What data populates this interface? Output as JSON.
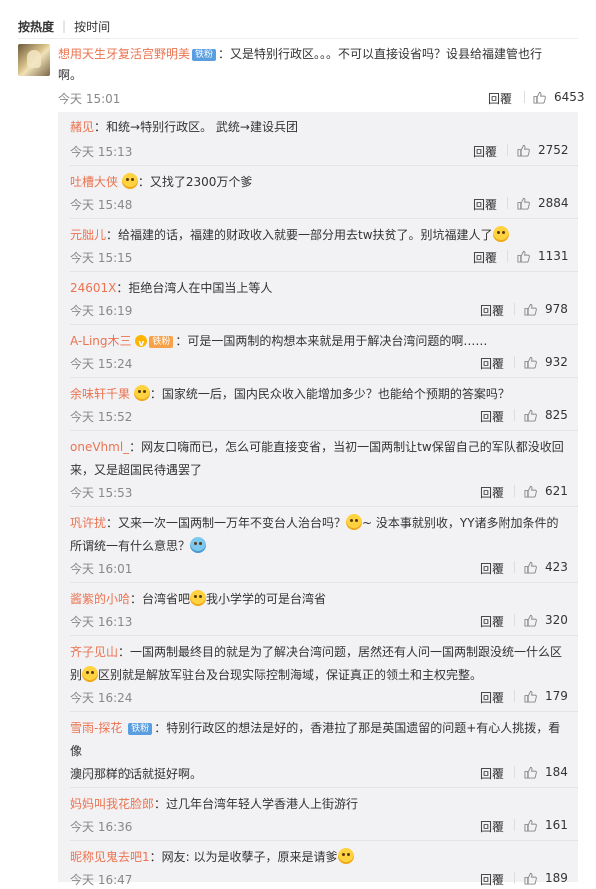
{
  "sort": {
    "hot": "按热度",
    "time": "按时间"
  },
  "main_comment": {
    "user": "想用天生牙复活宫野明美",
    "badge": "铁粉",
    "text_line1": "：又是特别行政区。。。不可以直接设省吗？设县给福建管也行",
    "text_line2": "啊。",
    "time": "今天 15:01",
    "reply_label": "回覆",
    "likes": "6453"
  },
  "reply_label": "回覆",
  "replies": [
    {
      "user": "赭见",
      "line1": "：和统→特别行政区。 武统→建设兵团",
      "line2": "",
      "time": "今天 15:13",
      "likes": "2752"
    },
    {
      "user": "吐槽大侠",
      "line1": "：又找了2300万个爹",
      "line2": "",
      "time": "今天 15:48",
      "likes": "2884"
    },
    {
      "user": "元胐儿",
      "line1": "：给福建的话，福建的财政收入就要一部分用去tw扶贫了。别坑福建人了",
      "line2": "",
      "time": "今天 15:15",
      "likes": "1131"
    },
    {
      "user": "24601X",
      "line1": "：拒绝台湾人在中国当上等人",
      "line2": "",
      "time": "今天 16:19",
      "likes": "978"
    },
    {
      "user": "A-Ling木三",
      "badge": "铁粉",
      "line1": "：可是一国两制的构想本来就是用于解决台湾问题的啊……",
      "line2": "",
      "time": "今天 15:24",
      "likes": "932"
    },
    {
      "user": "余味轩千果",
      "line1": "：国家统一后，国内民众收入能增加多少？也能给个预期的答案吗？",
      "line2": "",
      "time": "今天 15:52",
      "likes": "825"
    },
    {
      "user": "oneVhml_",
      "line1": "：网友口嗨而已，怎么可能直接变省，当初一国两制让tw保留自己的军队都没收回",
      "line2": "来，又是超国民待遇罢了",
      "time": "今天 15:53",
      "likes": "621"
    },
    {
      "user": "巩许扰",
      "line1": "：又来一次一国两制一万年不变台人治台吗？",
      "line1b": "~ 没本事就别收，YY诸多附加条件的",
      "line2": "所谓统一有什么意思？",
      "time": "今天 16:01",
      "likes": "423"
    },
    {
      "user": "酱紫的小哈",
      "line1": "：台湾省吧",
      "line1b": "我小学学的可是台湾省",
      "line2": "",
      "time": "今天 16:13",
      "likes": "320"
    },
    {
      "user": "齐子见山",
      "line1": "：一国两制最终目的就是为了解决台湾问题，居然还有人问一国两制跟没统一什么区",
      "line2a": "别",
      "line2": "区别就是解放军驻台及台现实际控制海域，保证真正的领土和主权完整。",
      "time": "今天 16:24",
      "likes": "179"
    },
    {
      "user": "雪雨-探花",
      "badge": "铁粉",
      "line1": "：特别行政区的想法是好的，香港拉了那是英国遗留的问题+有心人挑拨，看像",
      "line2": "澳门那样的话就挺好啊。",
      "time": "今天 15:52",
      "likes": "184"
    },
    {
      "user": "妈妈叫我花脸郎",
      "line1": "：过几年台湾年轻人学香港人上街游行",
      "line2": "",
      "time": "今天 16:36",
      "likes": "161"
    },
    {
      "user": "昵称见鬼去吧1",
      "line1": "：网友: 以为是收孽子，原来是请爹",
      "line2": "",
      "time": "今天 16:47",
      "likes": "189"
    }
  ]
}
